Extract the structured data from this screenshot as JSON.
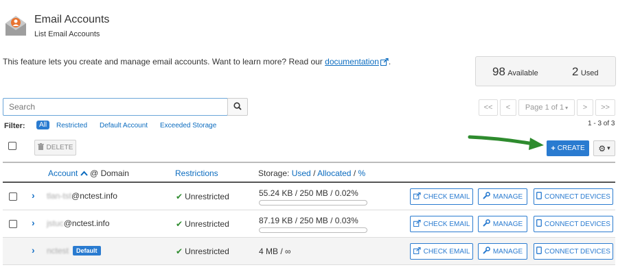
{
  "header": {
    "title": "Email Accounts",
    "subtitle": "List Email Accounts",
    "icon": "email-envelope-icon"
  },
  "intro": {
    "text": "This feature lets you create and manage email accounts. Want to learn more? Read our",
    "link": "documentation",
    "trailing": "."
  },
  "stats": {
    "available_count": "98",
    "available_label": "Available",
    "used_count": "2",
    "used_label": "Used"
  },
  "search": {
    "placeholder": "Search",
    "value": ""
  },
  "pagination": {
    "first": "<<",
    "prev": "<",
    "page_label": "Page 1 of 1",
    "next": ">",
    "last": ">>",
    "count": "1 - 3 of 3"
  },
  "filter": {
    "label": "Filter:",
    "options": [
      "All",
      "Restricted",
      "Default Account",
      "Exceeded Storage"
    ],
    "selected": "All"
  },
  "toolbar": {
    "delete_label": "DELETE",
    "create_label": "CREATE"
  },
  "table": {
    "columns": {
      "account": "Account",
      "domain": "@ Domain",
      "restrictions": "Restrictions",
      "storage": "Storage:",
      "used": "Used",
      "allocated": "Allocated",
      "percent": "%"
    },
    "rows": [
      {
        "account_blurred": "tlan-tst",
        "account_visible": "@nctest.info",
        "badge": "",
        "restriction": "Unrestricted",
        "storage": "55.24 KB / 250 MB / 0.02%",
        "usage_fraction": 0.0002,
        "has_checkbox": true
      },
      {
        "account_blurred": "jstuc",
        "account_visible": "@nctest.info",
        "badge": "",
        "restriction": "Unrestricted",
        "storage": "87.19 KB / 250 MB / 0.03%",
        "usage_fraction": 0.0003,
        "has_checkbox": true
      },
      {
        "account_blurred": "nctest",
        "account_visible": "",
        "badge": "Default",
        "restriction": "Unrestricted",
        "storage": "4 MB / ∞",
        "usage_fraction": null,
        "has_checkbox": false
      }
    ],
    "actions": {
      "check_email": "CHECK EMAIL",
      "manage": "MANAGE",
      "connect_devices": "CONNECT DEVICES"
    }
  },
  "colors": {
    "primary": "#2a7bd0",
    "link": "#0a6bbf",
    "success": "#2e8b2e",
    "arrow": "#2e8b2e"
  }
}
